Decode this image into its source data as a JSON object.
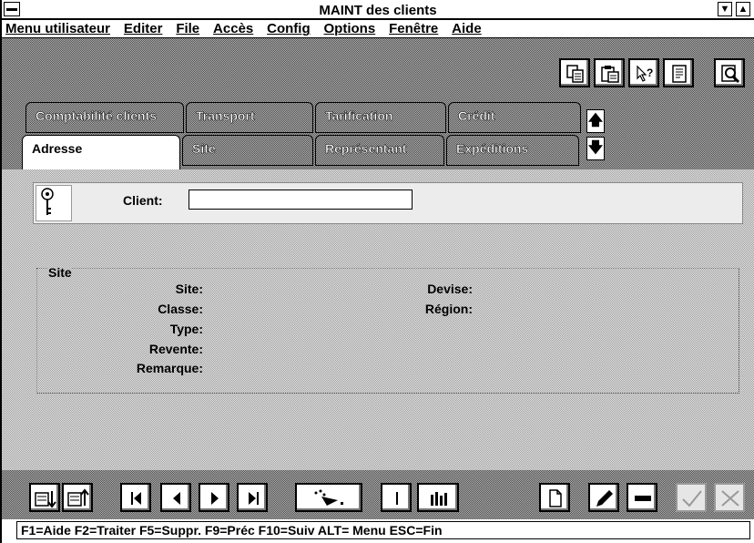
{
  "window": {
    "title": "MAINT des clients",
    "minimize_glyph": "▼",
    "maximize_glyph": "▲"
  },
  "menubar": {
    "items": [
      "Menu utilisateur",
      "Editer",
      "File",
      "Accès",
      "Config",
      "Options",
      "Fenêtre",
      "Aide"
    ]
  },
  "toolbar": {
    "buttons": [
      "copy-icon",
      "paste-icon",
      "help-pointer-icon",
      "notes-icon",
      "search-icon"
    ]
  },
  "tabs": {
    "top_row": [
      "Comptabilité clients",
      "Transport",
      "Tarification",
      "Crédit"
    ],
    "bottom_row": [
      "Adresse",
      "Site",
      "Représentant",
      "Expéditions"
    ],
    "active": "Adresse",
    "scroll_up": "🡅",
    "scroll_down": "🡇"
  },
  "main": {
    "client_label": "Client:",
    "client_value": "",
    "site_group": {
      "title": "Site",
      "left_labels": [
        "Site:",
        "Classe:",
        "Type:",
        "Revente:",
        "Remarque:"
      ],
      "right_labels": [
        "Devise:",
        "Région:"
      ]
    }
  },
  "bottom_toolbar": {
    "buttons": [
      "export-down-icon",
      "import-up-icon",
      "first-record-icon",
      "previous-record-icon",
      "next-record-icon",
      "last-record-icon",
      "wand-icon",
      "info-icon",
      "columns-icon",
      "new-record-icon",
      "edit-icon",
      "delete-icon",
      "confirm-icon",
      "cancel-icon"
    ]
  },
  "status": {
    "text": "F1=Aide  F2=Traiter  F5=Suppr.  F9=Préc  F10=Suiv  ALT= Menu  ESC=Fin"
  },
  "colors": {
    "background_pattern": "#c8c8c8",
    "frame": "#000000"
  }
}
